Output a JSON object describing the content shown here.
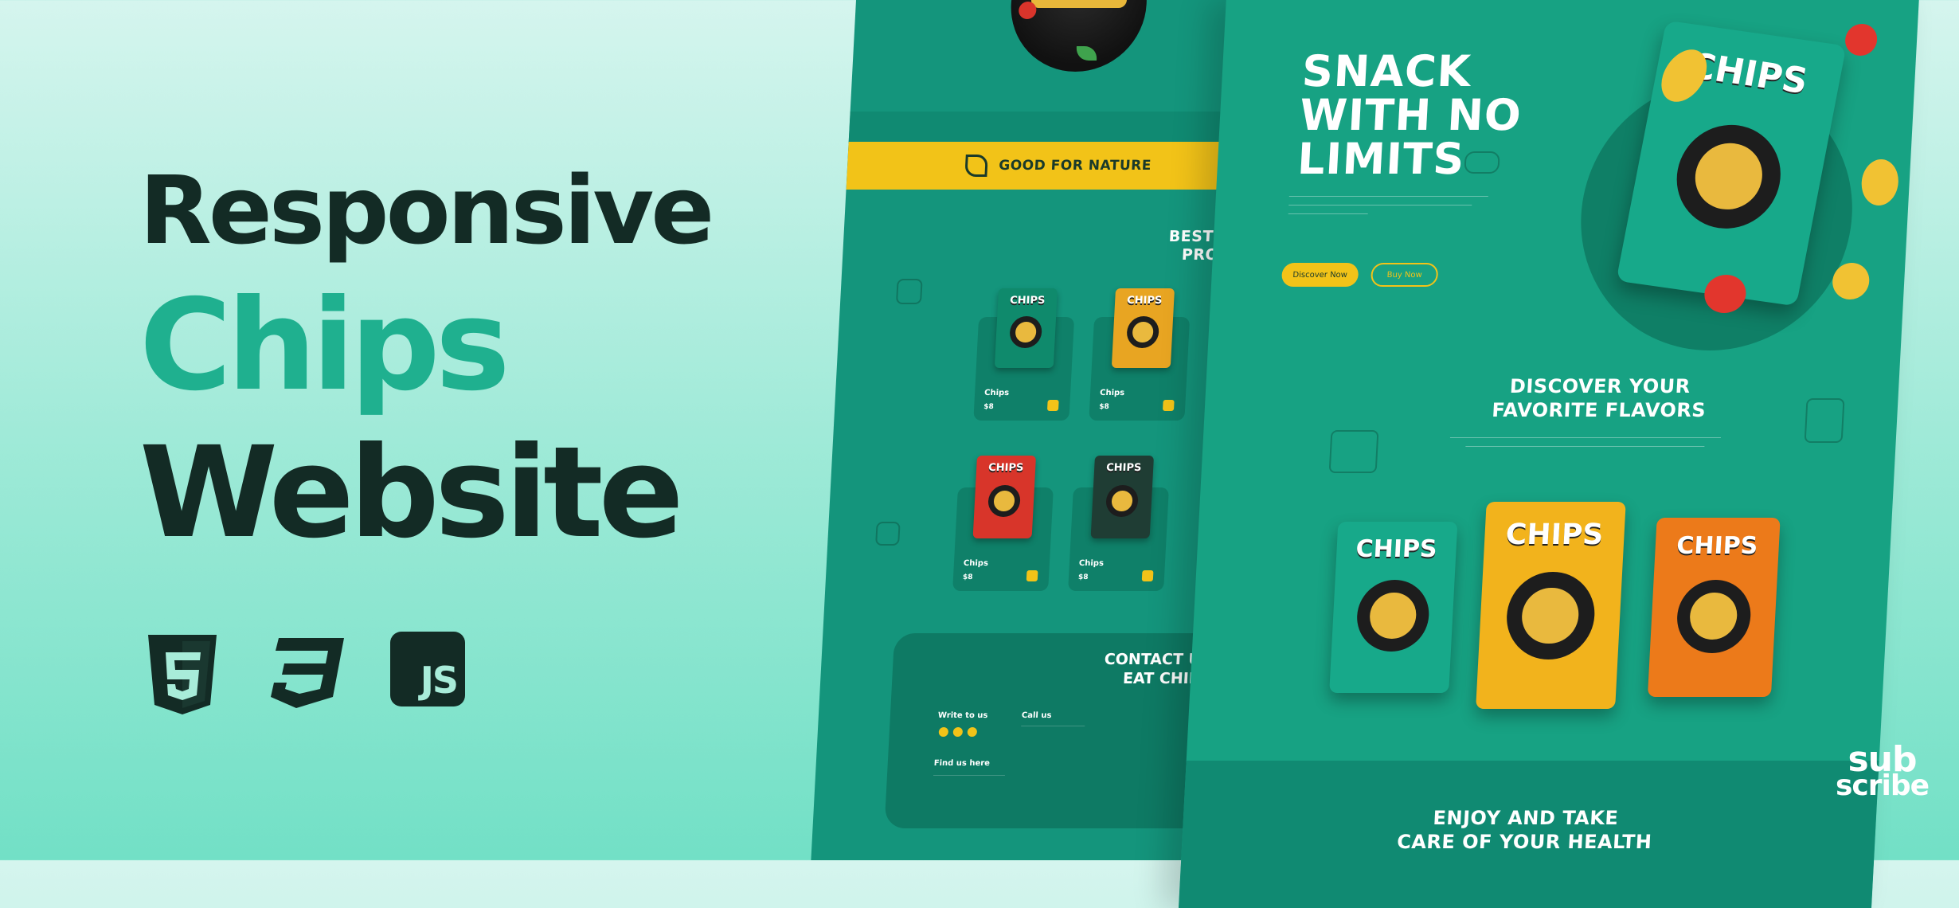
{
  "title": {
    "line1": "Responsive",
    "line2": "Chips",
    "line3": "Website"
  },
  "tech_icons": [
    {
      "icon": "html5-icon",
      "label": "5"
    },
    {
      "icon": "css3-icon",
      "label": "3"
    },
    {
      "icon": "javascript-icon",
      "label": "JS"
    }
  ],
  "colors": {
    "accent": "#1fb08f",
    "dark_text": "#132b25",
    "mockup_green": "#17a283",
    "yellow": "#f2c318"
  },
  "back_mockup": {
    "nature_label": "GOOD FOR NATURE",
    "products_title_line1": "BEST SELLI",
    "products_title_line2": "PRODUCT",
    "products": [
      {
        "bag_label": "CHIPS",
        "name": "Chips",
        "price": "$8"
      },
      {
        "bag_label": "CHIPS",
        "name": "Chips",
        "price": "$8"
      },
      {
        "bag_label": "CHIPS",
        "name": "Chips",
        "price": "$8"
      },
      {
        "bag_label": "CHIPS",
        "name": "Chips",
        "price": "$8"
      }
    ],
    "contact_title_line1": "CONTACT US",
    "contact_title_line2": "EAT CHIPS",
    "write_us": "Write to us",
    "call_us": "Call us",
    "find_us": "Find us here"
  },
  "front_mockup": {
    "hero_line1": "SNACK",
    "hero_line2": "WITH NO",
    "hero_line3": "LIMITS",
    "btn_primary": "Discover Now",
    "btn_secondary": "Buy Now",
    "hero_bag_label": "CHIPS",
    "flavors_title_line1": "DISCOVER YOUR",
    "flavors_title_line2": "FAVORITE FLAVORS",
    "flavor_bags": [
      "CHIPS",
      "CHIPS",
      "CHIPS"
    ],
    "footer_title_line1": "ENJOY AND TAKE",
    "footer_title_line2": "CARE OF YOUR HEALTH"
  },
  "subscribe": {
    "line1": "sub",
    "line2": "scribe"
  }
}
